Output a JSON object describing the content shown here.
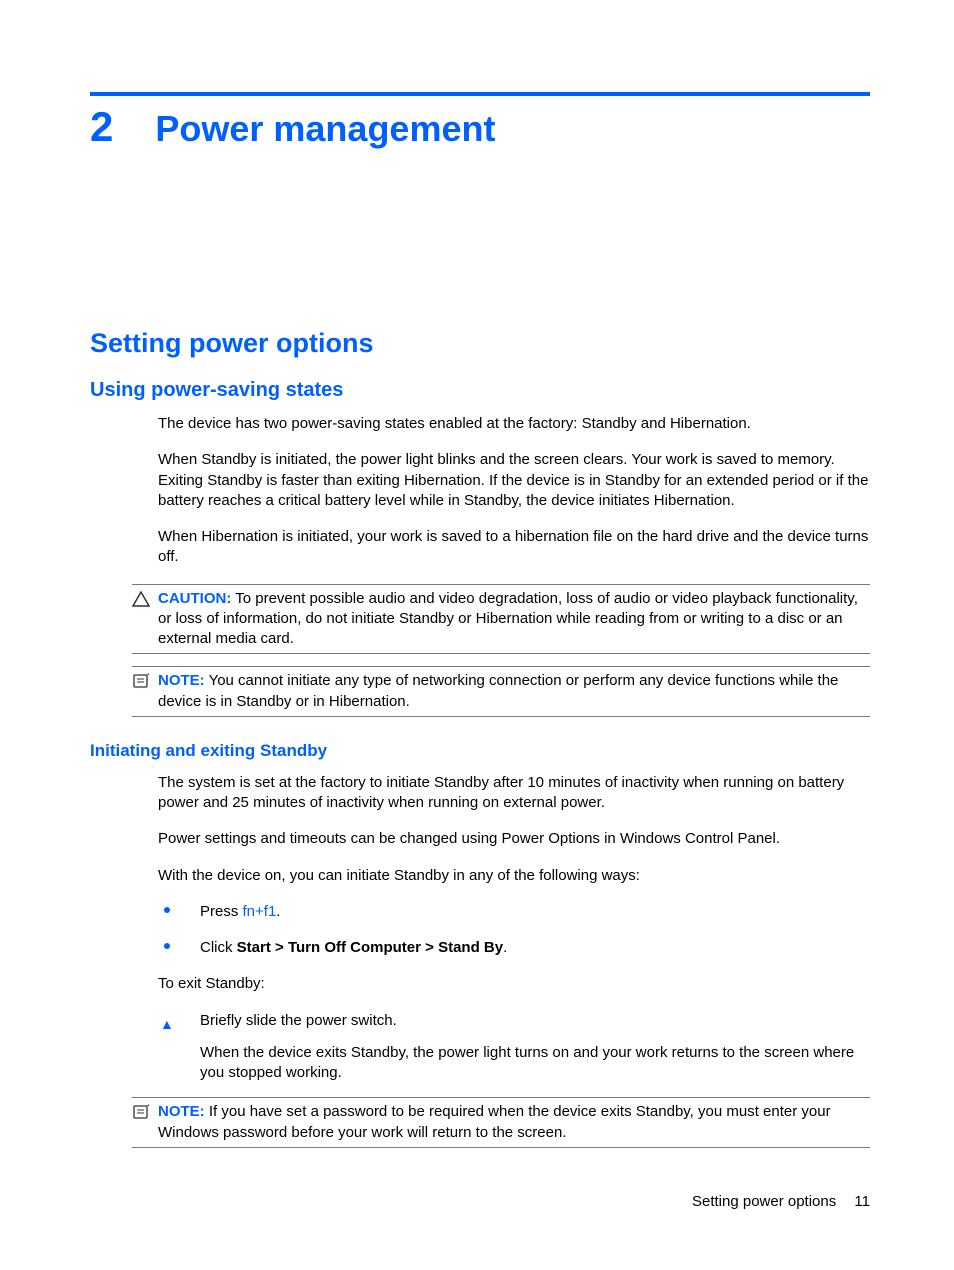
{
  "chapter": {
    "number": "2",
    "title": "Power management"
  },
  "h1": "Setting power options",
  "h2": "Using power-saving states",
  "p1": "The device has two power-saving states enabled at the factory: Standby and Hibernation.",
  "p2": "When Standby is initiated, the power light blinks and the screen clears. Your work is saved to memory. Exiting Standby is faster than exiting Hibernation. If the device is in Standby for an extended period or if the battery reaches a critical battery level while in Standby, the device initiates Hibernation.",
  "p3": "When Hibernation is initiated, your work is saved to a hibernation file on the hard drive and the device turns off.",
  "caution": {
    "label": "CAUTION:",
    "text": "To prevent possible audio and video degradation, loss of audio or video playback functionality, or loss of information, do not initiate Standby or Hibernation while reading from or writing to a disc or an external media card."
  },
  "note1": {
    "label": "NOTE:",
    "text": "You cannot initiate any type of networking connection or perform any device functions while the device is in Standby or in Hibernation."
  },
  "h3": "Initiating and exiting Standby",
  "p4": "The system is set at the factory to initiate Standby after 10 minutes of inactivity when running on battery power and 25 minutes of inactivity when running on external power.",
  "p5": "Power settings and timeouts can be changed using Power Options in Windows Control Panel.",
  "p6": "With the device on, you can initiate Standby in any of the following ways:",
  "bullets": {
    "b1_pre": "Press ",
    "b1_link": "fn+f1",
    "b1_post": ".",
    "b2_pre": "Click ",
    "b2_bold": "Start > Turn Off Computer > Stand By",
    "b2_post": "."
  },
  "p7": "To exit Standby:",
  "tri": {
    "t1": "Briefly slide the power switch.",
    "t1_sub": "When the device exits Standby, the power light turns on and your work returns to the screen where you stopped working."
  },
  "note2": {
    "label": "NOTE:",
    "text": "If you have set a password to be required when the device exits Standby, you must enter your Windows password before your work will return to the screen."
  },
  "footer": {
    "section": "Setting power options",
    "page": "11"
  }
}
